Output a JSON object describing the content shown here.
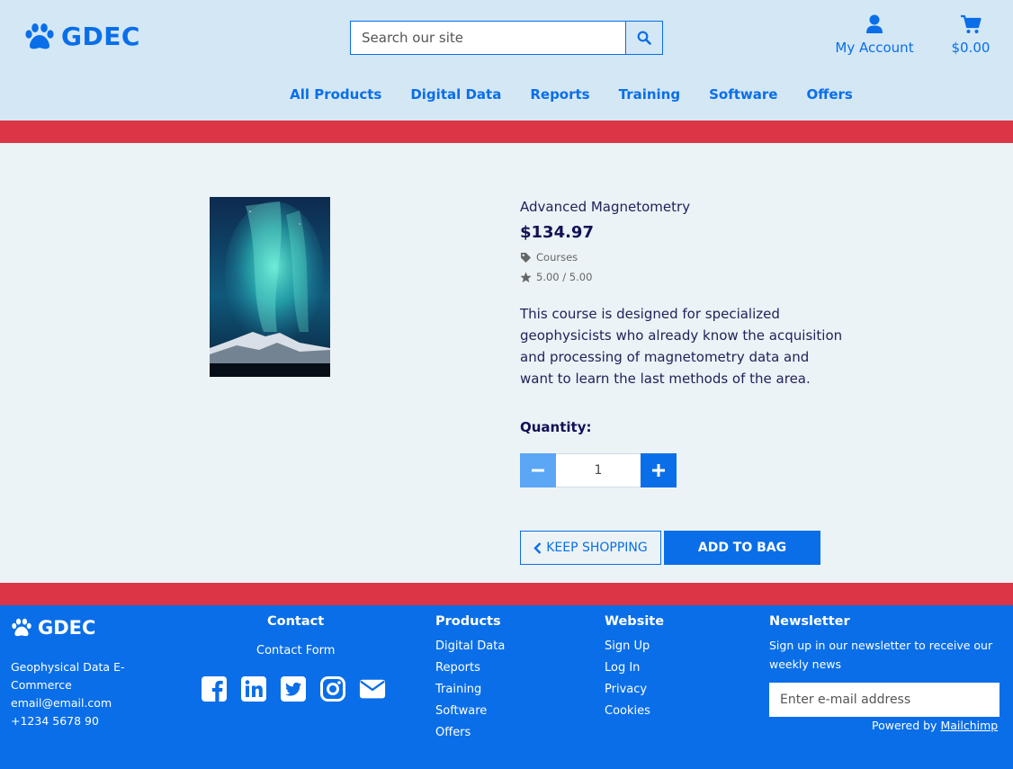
{
  "header": {
    "logo_text": "GDEC",
    "search_placeholder": "Search our site",
    "account_label": "My Account",
    "bag_total": "$0.00",
    "nav": [
      "All Products",
      "Digital Data",
      "Reports",
      "Training",
      "Software",
      "Offers"
    ]
  },
  "product": {
    "name": "Advanced Magnetometry",
    "price": "$134.97",
    "category": "Courses",
    "rating": "5.00 / 5.00",
    "description": "This course is designed for specialized geophysicists who already know the acquisition and processing of magnetometry data and want to learn the last methods of the area.",
    "quantity_label": "Quantity:",
    "quantity_value": "1",
    "keep_shopping_label": "KEEP SHOPPING",
    "add_to_bag_label": "ADD TO BAG"
  },
  "footer": {
    "logo_text": "GDEC",
    "about_lines": [
      "Geophysical Data E-",
      "Commerce",
      "email@email.com",
      "+1234 5678 90"
    ],
    "contact_title": "Contact",
    "contact_link": "Contact Form",
    "products_title": "Products",
    "products_links": [
      "Digital Data",
      "Reports",
      "Training",
      "Software",
      "Offers"
    ],
    "website_title": "Website",
    "website_links": [
      "Sign Up",
      "Log In",
      "Privacy",
      "Cookies"
    ],
    "newsletter_title": "Newsletter",
    "newsletter_text": "Sign up in our newsletter to receive our weekly news",
    "email_placeholder": "Enter e-mail address",
    "powered_prefix": "Powered by ",
    "powered_link": "Mailchimp"
  },
  "icons": {
    "logo": "paw-icon",
    "search": "search-icon",
    "account": "user-icon",
    "bag": "shopping-cart-icon",
    "category": "tag-icon",
    "rating": "star-icon",
    "minus": "minus-icon",
    "plus": "plus-icon",
    "back": "chevron-left-icon",
    "socials": [
      "facebook-icon",
      "linkedin-icon",
      "twitter-icon",
      "instagram-icon",
      "envelope-icon"
    ]
  },
  "colors": {
    "brand_blue": "#0a6ee8",
    "header_bg": "#d3e7f5",
    "accent_red": "#dc3545",
    "page_bg": "#ebf3f6"
  }
}
